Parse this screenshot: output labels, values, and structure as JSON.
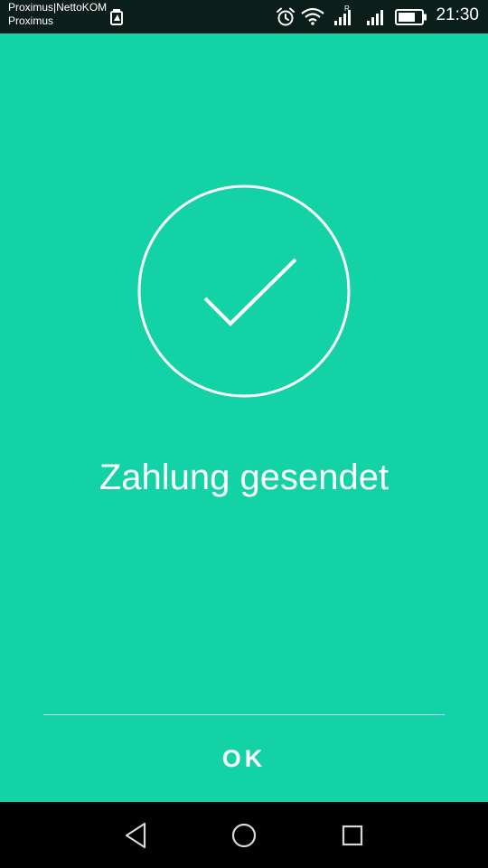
{
  "status_bar": {
    "carrier_line1": "Proximus|NettoKOM",
    "carrier_line2": "Proximus",
    "time": "21:30",
    "icons": [
      "sim-toolkit-icon",
      "alarm-icon",
      "wifi-icon",
      "roaming-signal-icon",
      "signal-icon",
      "battery-icon"
    ]
  },
  "screen": {
    "status_icon": "checkmark-circle-icon",
    "message": "Zahlung gesendet",
    "ok_label": "OK"
  },
  "nav_bar": {
    "buttons": [
      "back-icon",
      "home-icon",
      "recents-icon"
    ]
  },
  "colors": {
    "background": "#13d3a6",
    "status_bar": "#0b1e1a",
    "nav_bar": "#000000",
    "foreground": "#ffffff"
  }
}
